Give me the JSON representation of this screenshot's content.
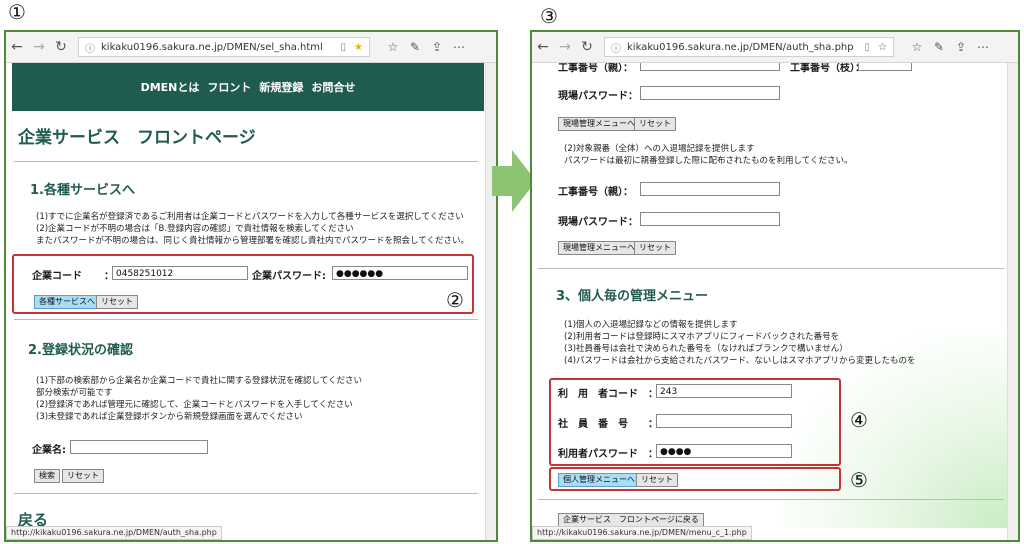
{
  "steps": {
    "s1": "①",
    "s2": "②",
    "s3": "③",
    "s4": "④",
    "s5": "⑤"
  },
  "left": {
    "url": "kikaku0196.sakura.ne.jp/DMEN/sel_sha.html",
    "nav": [
      "DMENとは",
      "フロント",
      "新規登録",
      "お問合せ"
    ],
    "page_title": "企業サービス　フロントページ",
    "section1": {
      "title": "1.各種サービスへ",
      "notes": [
        "(1)すでに企業名が登録済であるご利用者は企業コードとパスワードを入力して各種サービスを選択してください",
        "(2)企業コードが不明の場合は「B.登録内容の確認」で貴社情報を検索してください",
        "またパスワードが不明の場合は、同じく貴社情報から管理部署を確認し貴社内でパスワードを照会してください。"
      ],
      "code_label": "企業コード",
      "code_colon": "：",
      "code_value": "0458251012",
      "pw_label": "企業パスワード:",
      "pw_value": "●●●●●●",
      "submit": "各種サービスへ",
      "reset": "リセット"
    },
    "section2": {
      "title": "2.登録状況の確認",
      "notes": [
        "(1)下部の検索部から企業名か企業コードで貴社に関する登録状況を確認してください",
        "部分検索が可能です",
        "(2)登録済であれば管理元に確認して、企業コードとパスワードを入手してください",
        "(3)未登録であれば企業登録ボタンから新規登録画面を選んでください"
      ],
      "name_label": "企業名:",
      "search": "検索",
      "reset": "リセット"
    },
    "partial_heading": "戻る",
    "status": "http://kikaku0196.sakura.ne.jp/DMEN/auth_sha.php"
  },
  "right": {
    "url": "kikaku0196.sakura.ne.jp/DMEN/auth_sha.php",
    "top_label1": "工事番号（親）：",
    "top_label2": "工事番号（枝）：",
    "site_pw_label": "現場パスワード：",
    "site_menu_btn": "現場管理メニューへ",
    "reset": "リセット",
    "notes2": [
      "(2)対象親番（全体）への入退場記録を提供します",
      "パスワードは最初に親番登録した際に配布されたものを利用してください。"
    ],
    "parent_label": "工事番号（親）：",
    "site_pw_label2": "現場パスワード：",
    "site_menu_btn2": "現場管理メニューへ",
    "reset2": "リセット",
    "section3_title": "3、個人毎の管理メニュー",
    "notes3": [
      "(1)個人の入退場記録などの情報を提供します",
      "(2)利用者コードは登録時にスマホアプリにフィードバックされた番号を",
      "(3)社員番号は会社で決められた番号を（なければブランクで構いません）",
      "(4)パスワードは会社から支給されたパスワード、ないしはスマホアプリから変更したものを"
    ],
    "user_code_label": "利　用　者コード",
    "user_code_value": "243",
    "emp_label": "社　員　番　号",
    "user_pw_label": "利用者パスワード",
    "user_pw_value": "●●●●",
    "colon": "：",
    "personal_btn": "個人管理メニューへ",
    "personal_reset": "リセット",
    "back_btn": "企業サービス　フロントページに戻る",
    "status": "http://kikaku0196.sakura.ne.jp/DMEN/menu_c_1.php"
  },
  "colors": {
    "frame": "#4f8a3a",
    "banner": "#1f5c4f",
    "heading": "#1f5b4f",
    "highlight": "#c83232",
    "arrow": "#8cc474"
  }
}
